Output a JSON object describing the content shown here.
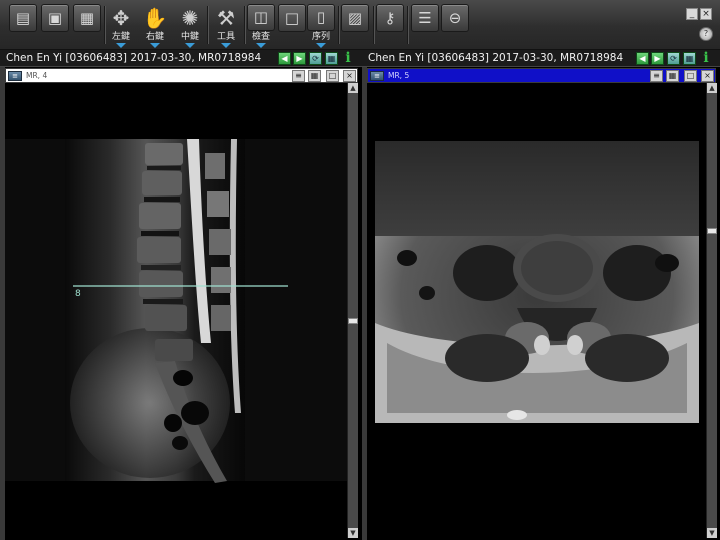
{
  "toolbar": {
    "buttons": [
      {
        "icon": "patient-list-icon",
        "label": "",
        "glyph": "▤"
      },
      {
        "icon": "save-icon",
        "label": "",
        "glyph": "▣"
      },
      {
        "icon": "layout-grid-icon",
        "label": "",
        "glyph": "▦"
      },
      {
        "icon": "move-arrows-icon",
        "label": "左鍵",
        "glyph": "✥"
      },
      {
        "icon": "hand-pan-icon",
        "label": "右鍵",
        "glyph": "✋"
      },
      {
        "icon": "brightness-icon",
        "label": "中鍵",
        "glyph": "✺"
      },
      {
        "icon": "tools-icon",
        "label": "工具",
        "glyph": "⚒"
      },
      {
        "icon": "compare-icon",
        "label": "檢查",
        "glyph": "◫"
      },
      {
        "icon": "single-frame-icon",
        "label": "",
        "glyph": "□"
      },
      {
        "icon": "series-icon",
        "label": "序列",
        "glyph": "▯"
      },
      {
        "icon": "image-icon",
        "label": "",
        "glyph": "▨"
      },
      {
        "icon": "key-image-icon",
        "label": "",
        "glyph": "⚷"
      },
      {
        "icon": "report-icon",
        "label": "",
        "glyph": "☰"
      },
      {
        "icon": "exit-icon",
        "label": "",
        "glyph": "⊖"
      }
    ],
    "window": {
      "minimize": "_",
      "close": "×",
      "help": "?"
    }
  },
  "panels": {
    "left": {
      "title": "Chen En Yi [03606483] 2017-03-30, MR0718984",
      "series_label": "MR, 4",
      "series_active": false,
      "reference_line_label": "8"
    },
    "right": {
      "title": "Chen En Yi [03606483] 2017-03-30, MR0718984",
      "series_label": "MR, 5",
      "series_active": true
    }
  },
  "glyphs": {
    "prev": "◀",
    "next": "▶",
    "sync": "⟳",
    "tile": "▦",
    "info": "i",
    "menu": "≡",
    "maximize": "□",
    "close": "×",
    "scroll_up": "▲",
    "scroll_down": "▼"
  },
  "colors": {
    "toolbar_bg": "#2e2e2e",
    "nav_button_green": "#2d9a3c",
    "active_series_blue": "#1010c8",
    "reference_line": "#9fe0cf",
    "dropdown_caret": "#3a9cd8"
  }
}
